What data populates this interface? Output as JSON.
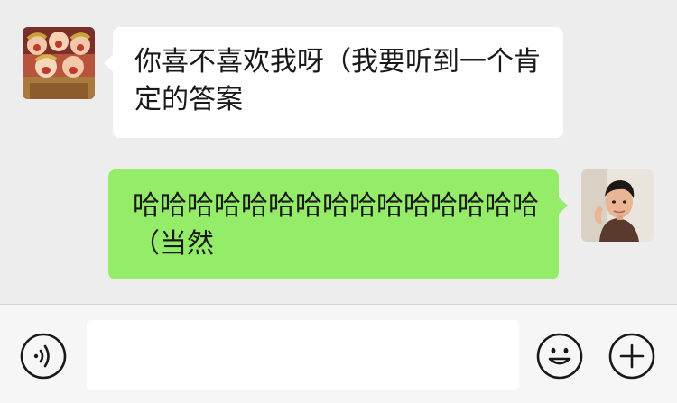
{
  "messages": [
    {
      "sender": "other",
      "avatar_icon": "cartoon-group-avatar-icon",
      "text": "你喜不喜欢我呀（我要听到一个肯定的答案"
    },
    {
      "sender": "self",
      "avatar_icon": "man-portrait-avatar-icon",
      "text": "哈哈哈哈哈哈哈哈哈哈哈哈哈哈哈（当然"
    }
  ],
  "input_bar": {
    "text_value": "",
    "voice_icon": "voice-icon",
    "emoji_icon": "emoji-icon",
    "plus_icon": "plus-icon"
  },
  "colors": {
    "background": "#ededed",
    "received_bubble": "#ffffff",
    "sent_bubble": "#95ec69",
    "input_bar": "#f6f6f6",
    "icon_stroke": "#181818"
  }
}
